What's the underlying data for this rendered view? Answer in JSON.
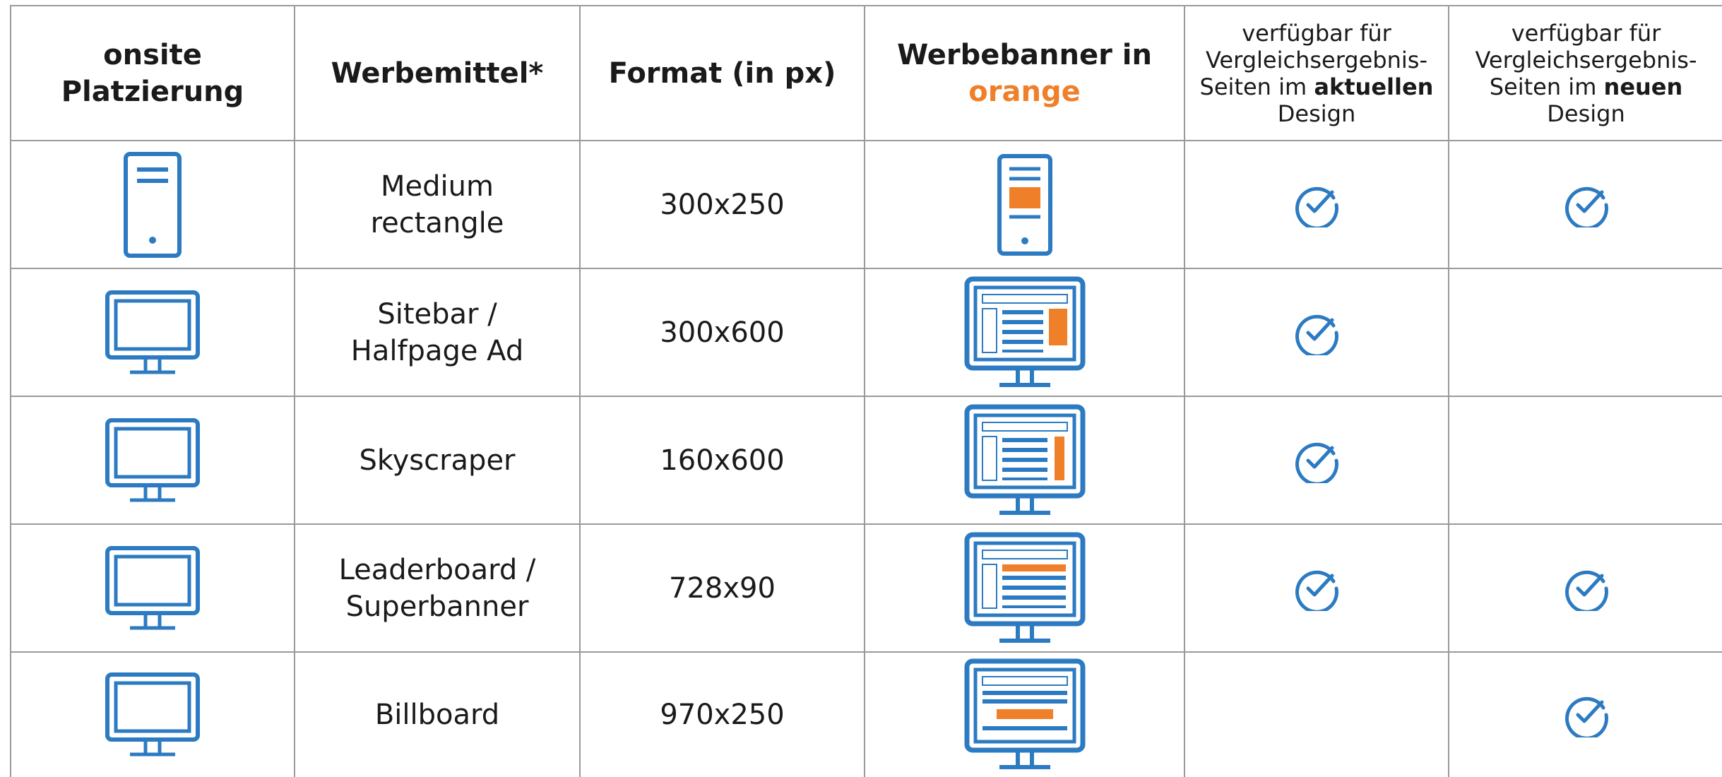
{
  "colors": {
    "blue": "#2c7bc2",
    "orange": "#f07f2a",
    "grid": "#9a9a9a"
  },
  "header": {
    "col1": {
      "line1": "onsite",
      "line2": "Platzierung"
    },
    "col2": "Werbemittel*",
    "col3": "Format (in px)",
    "col4": {
      "line1": "Werbebanner in",
      "line2": "orange"
    },
    "col5": {
      "line1": "verfügbar für",
      "line2": "Vergleichsergebnis-",
      "line3_pre": "Seiten im ",
      "line3_bold": "aktuellen",
      "line4": "Design"
    },
    "col6": {
      "line1": "verfügbar für",
      "line2": "Vergleichsergebnis-",
      "line3_pre": "Seiten im ",
      "line3_bold": "neuen",
      "line4": "Design"
    }
  },
  "rows": [
    {
      "device_icon": "mobile-icon",
      "name_line1": "Medium",
      "name_line2": "rectangle",
      "format": "300x250",
      "banner_icon": "mobile-banner-medium-rectangle-icon",
      "current_design": true,
      "new_design": true
    },
    {
      "device_icon": "desktop-monitor-icon",
      "name_line1": "Sitebar /",
      "name_line2": "Halfpage Ad",
      "format": "300x600",
      "banner_icon": "desktop-banner-sitebar-icon",
      "current_design": true,
      "new_design": false
    },
    {
      "device_icon": "desktop-monitor-icon",
      "name_line1": "Skyscraper",
      "name_line2": "",
      "format": "160x600",
      "banner_icon": "desktop-banner-skyscraper-icon",
      "current_design": true,
      "new_design": false
    },
    {
      "device_icon": "desktop-monitor-icon",
      "name_line1": "Leaderboard /",
      "name_line2": "Superbanner",
      "format": "728x90",
      "banner_icon": "desktop-banner-leaderboard-icon",
      "current_design": true,
      "new_design": true
    },
    {
      "device_icon": "desktop-monitor-icon",
      "name_line1": "Billboard",
      "name_line2": "",
      "format": "970x250",
      "banner_icon": "desktop-banner-billboard-icon",
      "current_design": false,
      "new_design": true
    }
  ]
}
